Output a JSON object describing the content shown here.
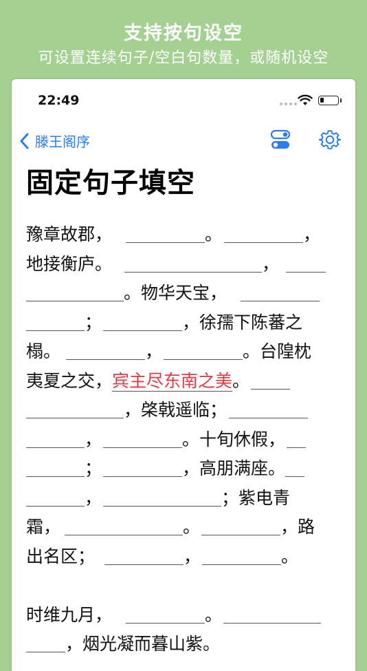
{
  "banner": {
    "title": "支持按句设空",
    "subtitle": "可设置连续句子/空白句数量，或随机设空"
  },
  "status_bar": {
    "time": "22:49"
  },
  "nav": {
    "back_label": "滕王阁序"
  },
  "page": {
    "title": "固定句子填空"
  },
  "text": {
    "l1a": "豫章故郡，",
    "l1b": "。",
    "l1c": "，",
    "l2a": "地接衡庐。",
    "l2b": "，",
    "l3a": "。物华天宝，",
    "l4a": "；",
    "l4b": "，徐孺下陈蕃之",
    "l5a": "榻。",
    "l5b": "，",
    "l5c": "。台隍枕",
    "l6a": "夷夏之交，",
    "l6h": "宾主尽东南之美",
    "l6b": "。",
    "l7a": "，棨戟遥临；",
    "l8a": "，",
    "l8b": "。十旬休假，",
    "l9a": "；",
    "l9b": "，高朋满座。",
    "l10a": "，",
    "l10b": "；紫电青",
    "l11a": "霜，",
    "l11b": "。",
    "l11c": "，路",
    "l12a": "出名区；",
    "l12b": "，",
    "l12c": "。",
    "l13a": "时维九月，",
    "l13b": "。",
    "l14a": "，烟光凝而暮山紫。"
  }
}
